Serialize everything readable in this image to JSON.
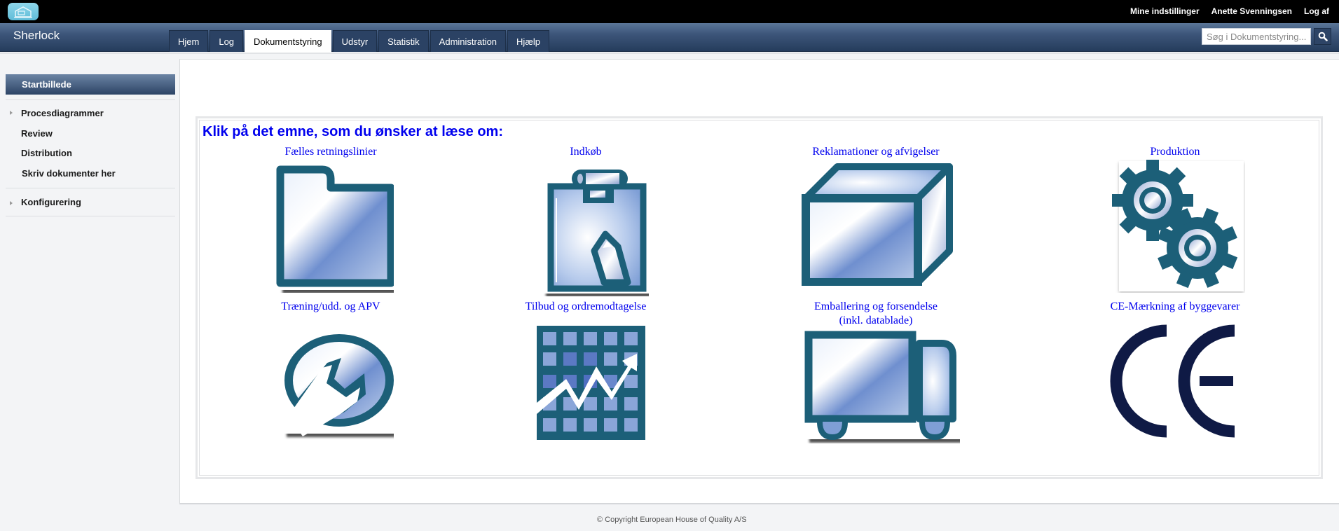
{
  "topbar": {
    "links": [
      "Mine indstillinger",
      "Anette Svenningsen",
      "Log af"
    ]
  },
  "navbar": {
    "brand": "Sherlock",
    "tabs": [
      {
        "label": "Hjem",
        "active": false
      },
      {
        "label": "Log",
        "active": false
      },
      {
        "label": "Dokumentstyring",
        "active": true
      },
      {
        "label": "Udstyr",
        "active": false
      },
      {
        "label": "Statistik",
        "active": false
      },
      {
        "label": "Administration",
        "active": false
      },
      {
        "label": "Hjælp",
        "active": false
      }
    ],
    "search_placeholder": "Søg i Dokumentstyring...",
    "search_icon": "magnifier-icon"
  },
  "sidebar": {
    "active": "Startbillede",
    "items": [
      {
        "label": "Procesdiagrammer",
        "expandable": true
      },
      {
        "label": "Review",
        "expandable": false
      },
      {
        "label": "Distribution",
        "expandable": false
      },
      {
        "label": "Skriv dokumenter her",
        "expandable": false
      },
      {
        "label": "Konfigurering",
        "expandable": true
      }
    ]
  },
  "main": {
    "heading": "Klik på det emne, som du ønsker at læse om:",
    "topics": [
      {
        "label": "Fælles retningslinier",
        "icon": "folder-icon"
      },
      {
        "label": "Indkøb",
        "icon": "clipboard-icon"
      },
      {
        "label": "Reklamationer og afvigelser",
        "icon": "box-icon"
      },
      {
        "label": "Produktion",
        "icon": "gears-icon"
      },
      {
        "label": "Træning/udd. og APV",
        "icon": "wrench-icon"
      },
      {
        "label": "Tilbud og ordremodtagelse",
        "icon": "growth-chart-icon"
      },
      {
        "label": "Emballering og forsendelse",
        "label2": "(inkl. datablade)",
        "icon": "truck-icon"
      },
      {
        "label": "CE-Mærkning af byggevarer",
        "icon": "ce-mark-icon"
      }
    ]
  },
  "colors": {
    "accent_teal": "#1c5f78",
    "link_blue": "#0000ee",
    "nav_dark": "#2b4264",
    "ce_navy": "#0f1a45"
  },
  "footer": {
    "copyright": "© Copyright European House of Quality A/S"
  }
}
